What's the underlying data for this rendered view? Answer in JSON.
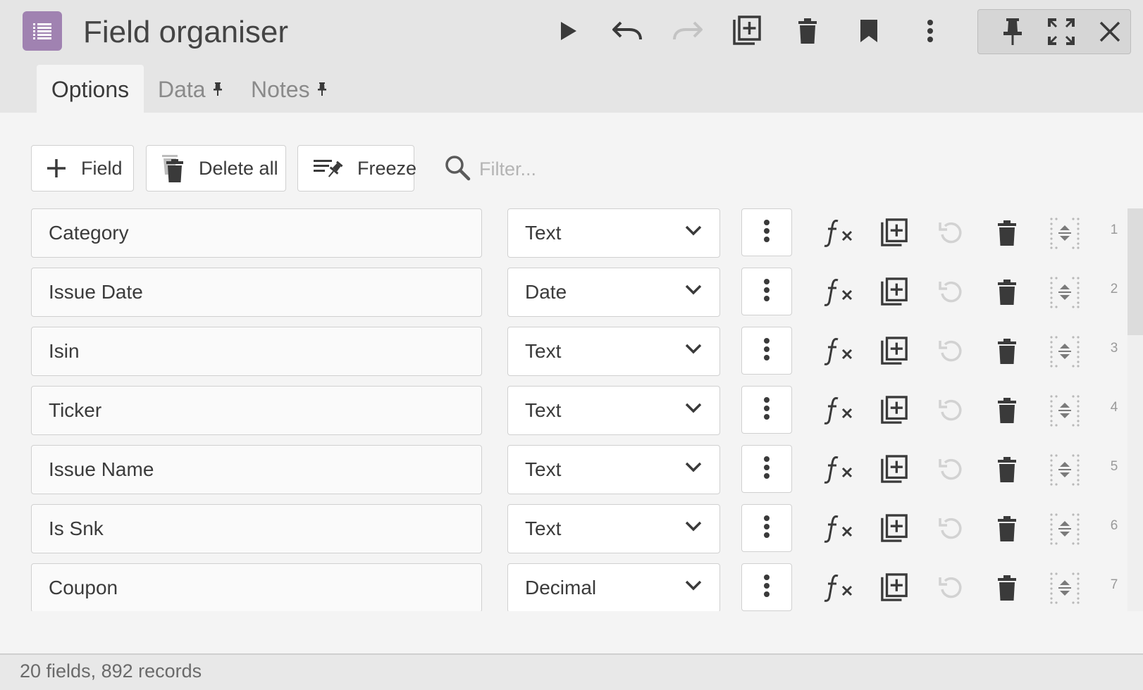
{
  "window": {
    "title": "Field organiser",
    "app_icon": "list-icon",
    "accent_color": "#a082b1"
  },
  "toolbar_icons": [
    "play-icon",
    "undo-icon",
    "redo-icon",
    "duplicate-icon",
    "trash-icon",
    "bookmark-icon",
    "more-vertical-icon"
  ],
  "window_controls": [
    "pin-icon",
    "fullscreen-icon",
    "close-icon"
  ],
  "tabs": [
    {
      "label": "Options",
      "active": true
    },
    {
      "label": "Data",
      "active": false,
      "pinned": true
    },
    {
      "label": "Notes",
      "active": false,
      "pinned": true
    }
  ],
  "actions": {
    "add_field_label": "Field",
    "delete_all_label": "Delete all",
    "freeze_label": "Freeze",
    "filter_placeholder": "Filter..."
  },
  "fields": [
    {
      "name": "Category",
      "type": "Text",
      "index": "1"
    },
    {
      "name": "Issue Date",
      "type": "Date",
      "index": "2"
    },
    {
      "name": "Isin",
      "type": "Text",
      "index": "3"
    },
    {
      "name": "Ticker",
      "type": "Text",
      "index": "4"
    },
    {
      "name": "Issue Name",
      "type": "Text",
      "index": "5"
    },
    {
      "name": "Is Snk",
      "type": "Text",
      "index": "6"
    },
    {
      "name": "Coupon",
      "type": "Decimal",
      "index": "7"
    }
  ],
  "status": {
    "text": "20 fields, 892 records"
  }
}
